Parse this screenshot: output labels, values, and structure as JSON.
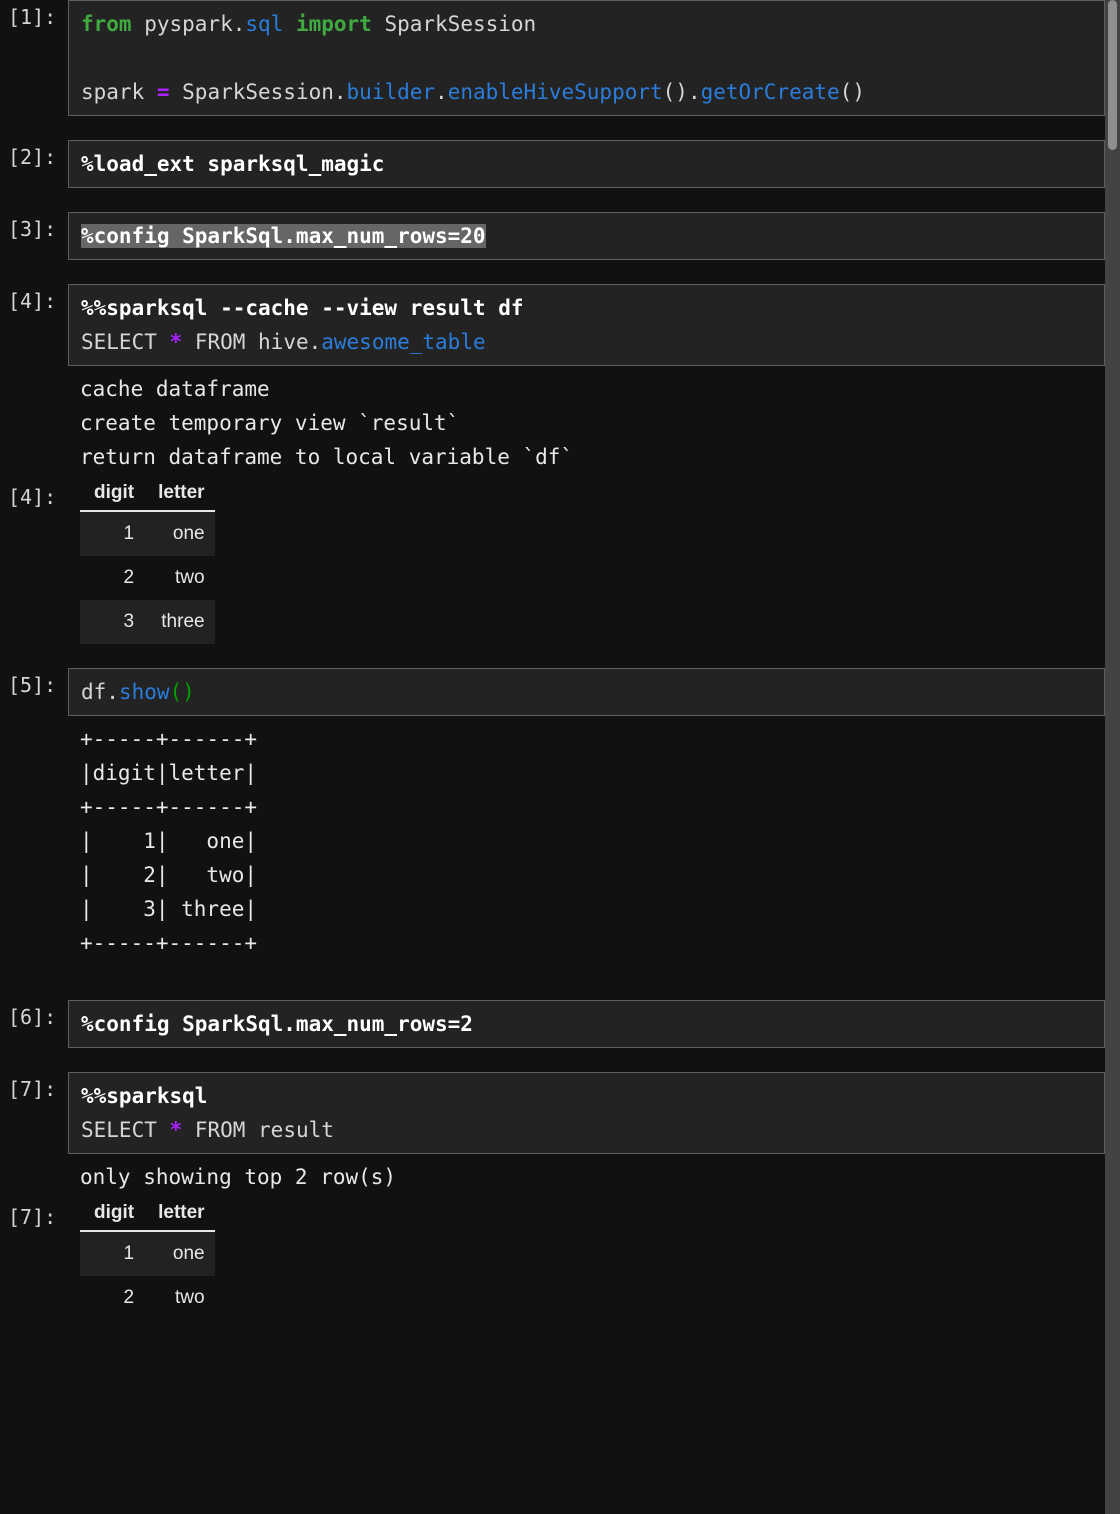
{
  "notebook": {
    "theme": {
      "page_background": "#111111",
      "cell_background": "#232323",
      "cell_border": "#5e5e5e",
      "text": "#d6d6d6",
      "keyword": "#40a940",
      "module": "#2a7ddb",
      "operator": "#aa22ff",
      "paren": "#00a000",
      "selection": "#666666",
      "scrollbar_track": "#434343",
      "scrollbar_thumb": "#8f8f8f"
    },
    "cells": [
      {
        "prompt": "[1]:",
        "input_lines": [
          "from pyspark.sql import SparkSession",
          "",
          "spark = SparkSession.builder.enableHiveSupport().getOrCreate()"
        ]
      },
      {
        "prompt": "[2]:",
        "input_lines": [
          "%load_ext sparksql_magic"
        ]
      },
      {
        "prompt": "[3]:",
        "input_lines": [
          "%config SparkSql.max_num_rows=20"
        ],
        "selected": true
      },
      {
        "prompt": "[4]:",
        "input_lines": [
          "%%sparksql --cache --view result df",
          "SELECT * FROM hive.awesome_table"
        ],
        "output_text": [
          "cache dataframe",
          "create temporary view `result`",
          "return dataframe to local variable `df`"
        ],
        "output_prompt": "[4]:",
        "table": {
          "columns": [
            "digit",
            "letter"
          ],
          "rows": [
            [
              "1",
              "one"
            ],
            [
              "2",
              "two"
            ],
            [
              "3",
              "three"
            ]
          ]
        }
      },
      {
        "prompt": "[5]:",
        "input_lines": [
          "df.show()"
        ],
        "output_text": [
          "+-----+------+",
          "|digit|letter|",
          "+-----+------+",
          "|    1|   one|",
          "|    2|   two|",
          "|    3| three|",
          "+-----+------+"
        ]
      },
      {
        "prompt": "[6]:",
        "input_lines": [
          "%config SparkSql.max_num_rows=2"
        ]
      },
      {
        "prompt": "[7]:",
        "input_lines": [
          "%%sparksql",
          "SELECT * FROM result"
        ],
        "output_text": [
          "only showing top 2 row(s)"
        ],
        "output_prompt": "[7]:",
        "table": {
          "columns": [
            "digit",
            "letter"
          ],
          "rows": [
            [
              "1",
              "one"
            ],
            [
              "2",
              "two"
            ]
          ]
        }
      }
    ]
  },
  "cell1": {
    "prompt": "[1]:",
    "l1_kw": "from",
    "l1_mid": " pyspark.",
    "l1_mod": "sql",
    "l1_kw2": " import",
    "l1_tail": " SparkSession",
    "l3_a": "spark ",
    "l3_op": "=",
    "l3_b": " SparkSession.",
    "l3_mod1": "builder",
    "l3_dot1": ".",
    "l3_mod2": "enableHiveSupport",
    "l3_p1": "()",
    "l3_dot2": ".",
    "l3_mod3": "getOrCreate",
    "l3_p2": "()"
  },
  "cell2": {
    "prompt": "[2]:",
    "line": "%load_ext sparksql_magic"
  },
  "cell3": {
    "prompt": "[3]:",
    "line": "%config SparkSql.max_num_rows=20"
  },
  "cell4": {
    "prompt": "[4]:",
    "line1": "%%sparksql --cache --view result df",
    "l2_a": "SELECT ",
    "l2_star": "*",
    "l2_b": " FROM hive.",
    "l2_tbl": "awesome_table",
    "out1": "cache dataframe",
    "out2": "create temporary view `result`",
    "out3": "return dataframe to local variable `df`",
    "out_prompt": "[4]:",
    "col1": "digit",
    "col2": "letter",
    "r1c1": "1",
    "r1c2": "one",
    "r2c1": "2",
    "r2c2": "two",
    "r3c1": "3",
    "r3c2": "three"
  },
  "cell5": {
    "prompt": "[5]:",
    "l1_a": "df.",
    "l1_fn": "show",
    "l1_p": "()",
    "out1": "+-----+------+",
    "out2": "|digit|letter|",
    "out3": "+-----+------+",
    "out4": "|    1|   one|",
    "out5": "|    2|   two|",
    "out6": "|    3| three|",
    "out7": "+-----+------+"
  },
  "cell6": {
    "prompt": "[6]:",
    "line": "%config SparkSql.max_num_rows=2"
  },
  "cell7": {
    "prompt": "[7]:",
    "line1": "%%sparksql",
    "l2_a": "SELECT ",
    "l2_star": "*",
    "l2_b": " FROM result",
    "out1": "only showing top 2 row(s)",
    "out_prompt": "[7]:",
    "col1": "digit",
    "col2": "letter",
    "r1c1": "1",
    "r1c2": "one",
    "r2c1": "2",
    "r2c2": "two"
  }
}
